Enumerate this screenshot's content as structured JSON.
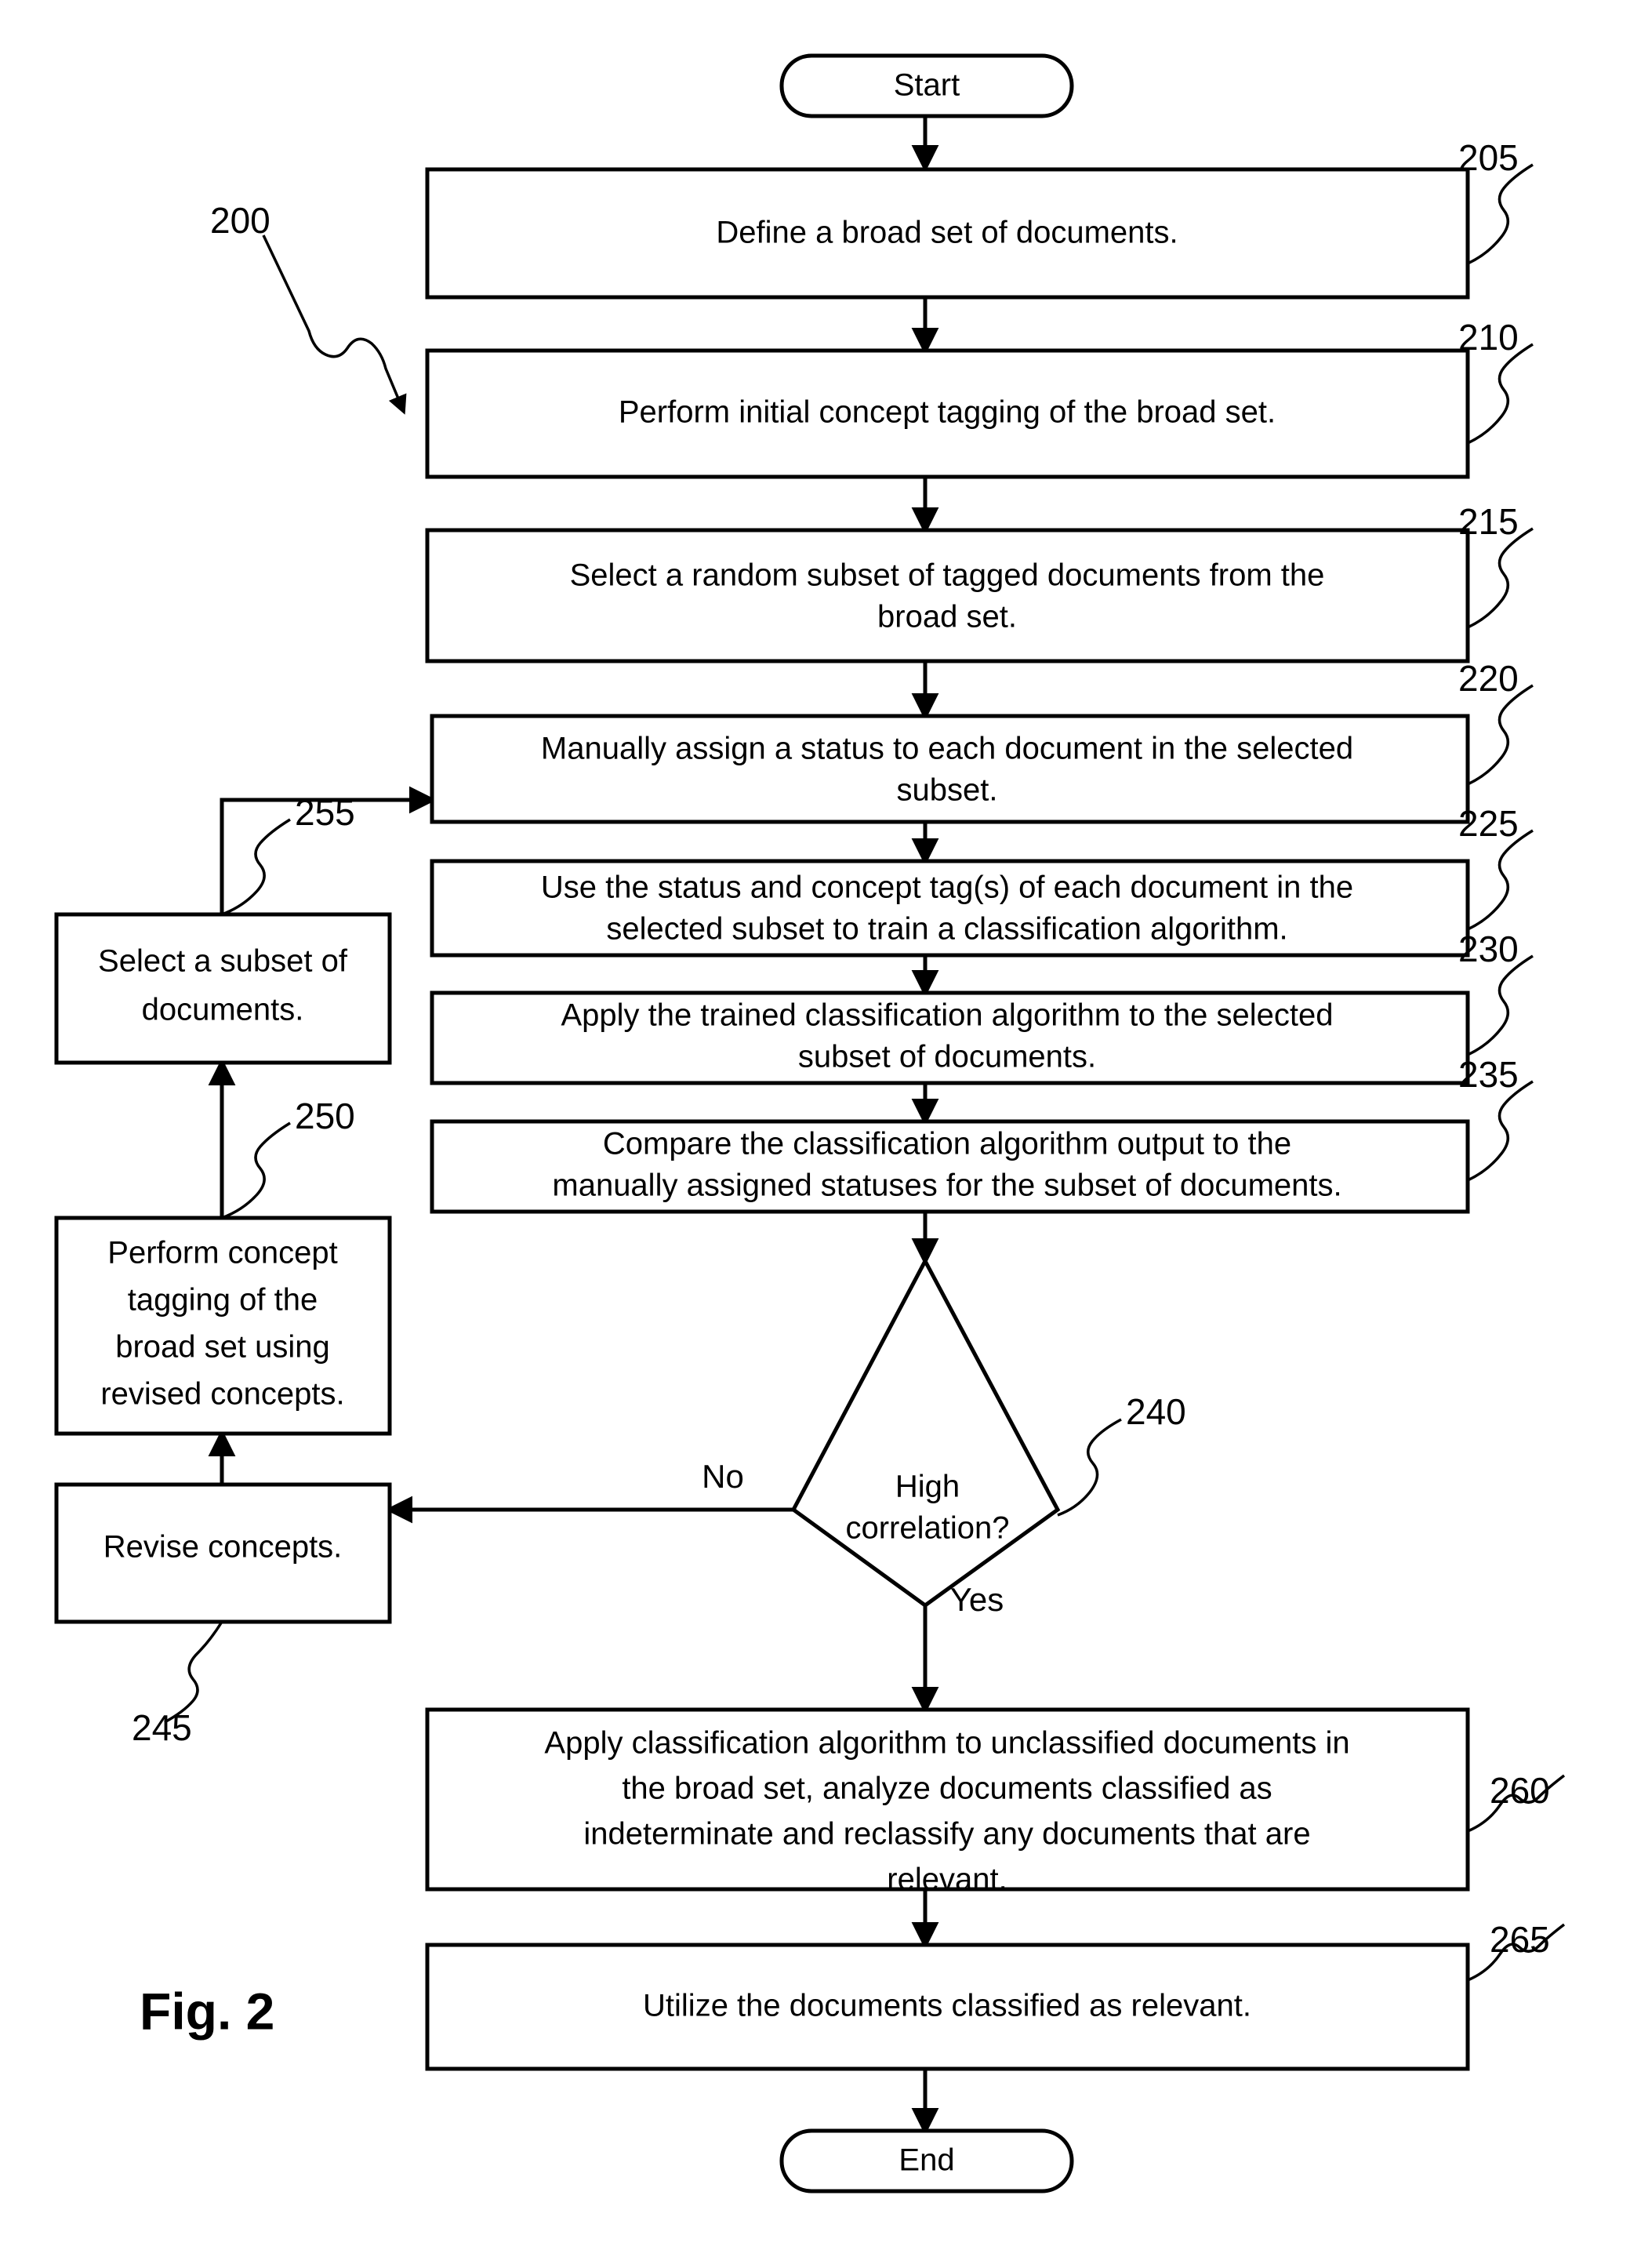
{
  "figure": {
    "caption": "Fig. 2",
    "diagram_ref": "200"
  },
  "terminators": {
    "start": "Start",
    "end": "End"
  },
  "decision_labels": {
    "no": "No",
    "yes": "Yes"
  },
  "refs": {
    "r200": "200",
    "r205": "205",
    "r210": "210",
    "r215": "215",
    "r220": "220",
    "r225": "225",
    "r230": "230",
    "r235": "235",
    "r240": "240",
    "r245": "245",
    "r250": "250",
    "r255": "255",
    "r260": "260",
    "r265": "265"
  },
  "steps": {
    "s205": {
      "line1": "Define a broad set of documents."
    },
    "s210": {
      "line1": "Perform initial concept tagging of the broad set."
    },
    "s215": {
      "line1": "Select a random subset of tagged documents from the",
      "line2": "broad set."
    },
    "s220": {
      "line1": "Manually assign a status to each document in the selected",
      "line2": "subset."
    },
    "s225": {
      "line1": "Use the status and concept tag(s) of each document in the",
      "line2": "selected subset to train a classification algorithm."
    },
    "s230": {
      "line1": "Apply the trained classification algorithm to the selected",
      "line2": "subset of documents."
    },
    "s235": {
      "line1": "Compare the classification algorithm output to the",
      "line2": "manually assigned statuses for the subset of documents."
    },
    "s240": {
      "line1": "High",
      "line2": "correlation?"
    },
    "s245": {
      "line1": "Revise concepts."
    },
    "s250": {
      "line1": "Perform concept",
      "line2": "tagging of the",
      "line3": "broad set using",
      "line4": "revised concepts."
    },
    "s255": {
      "line1": "Select a subset of",
      "line2": "documents."
    },
    "s260": {
      "line1": "Apply classification algorithm to unclassified documents in",
      "line2": "the broad set, analyze documents classified as",
      "line3": "indeterminate and reclassify any documents that are",
      "line4": "relevant."
    },
    "s265": {
      "line1": "Utilize the documents classified as relevant."
    }
  }
}
